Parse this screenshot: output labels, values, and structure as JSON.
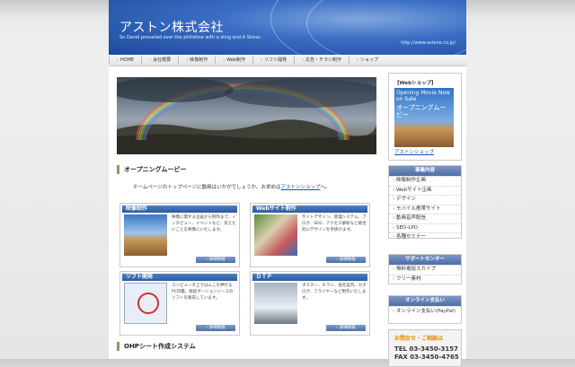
{
  "header": {
    "title": "アストン株式会社",
    "tagline": "So David prevailed over the philistine with a sling and A Stone.",
    "url": "http://www.astone.co.jp/"
  },
  "nav": {
    "items": [
      "HOME",
      "会社概要",
      "映像制作",
      "Web制作",
      "ソフト開発",
      "広告・チラシ制作",
      "ショップ"
    ]
  },
  "main": {
    "section1_title": "オープニングムービー",
    "intro_text": "ホームページのトップページに動画はいかがでしょうか。お求めは",
    "intro_link": "アストンショップ",
    "intro_suffix": "へ。",
    "cards": [
      {
        "title": "映像制作",
        "text": "映像に関する企画から制作まで、インタビュー、イベントなど、伝えたいことを映像にいたします。",
        "button": "› 詳細情報"
      },
      {
        "title": "Webサイト制作",
        "text": "サイトデザイン、管理システム、ブログ、SEO、アクセス解析など総合的にデザインを手掛けます。",
        "button": "› 詳細情報"
      },
      {
        "title": "ソフト開発",
        "text": "コンピュータ上ではんこを押せるPC印鑑、販促ボーションソースのソフトを販売しています。",
        "button": "› 詳細情報"
      },
      {
        "title": "ＤＴＰ",
        "text": "ポスター、チラシ、会社案内、カタログ、フライヤーなど制作いたします。",
        "button": "› 詳細情報"
      }
    ],
    "section2_title": "OHPシート作成システム"
  },
  "sidebar": {
    "shop": {
      "title": "【Webショップ】",
      "banner_en": "Opening Movie Now on Sale",
      "banner_jp": "オープニングムービー",
      "link": "アストンショップ"
    },
    "services": {
      "title": "事業内容",
      "items": [
        "映像制作企画",
        "Webサイト企画",
        "デザイン",
        "モバイル携帯サイト",
        "動画音声配信",
        "SEO-LPO",
        "各種セミナー"
      ]
    },
    "support": {
      "title": "サポートセンター",
      "items": [
        "無料電話スカイプ",
        "フリー素材"
      ]
    },
    "payment": {
      "title": "オンライン支払い",
      "items": [
        "オンライン支払い(PayPal)"
      ]
    },
    "contact": {
      "title": "お問合せ・ご相談は",
      "tel": "TEL 03-3450-3157",
      "fax": "FAX 03-3450-4765"
    }
  }
}
